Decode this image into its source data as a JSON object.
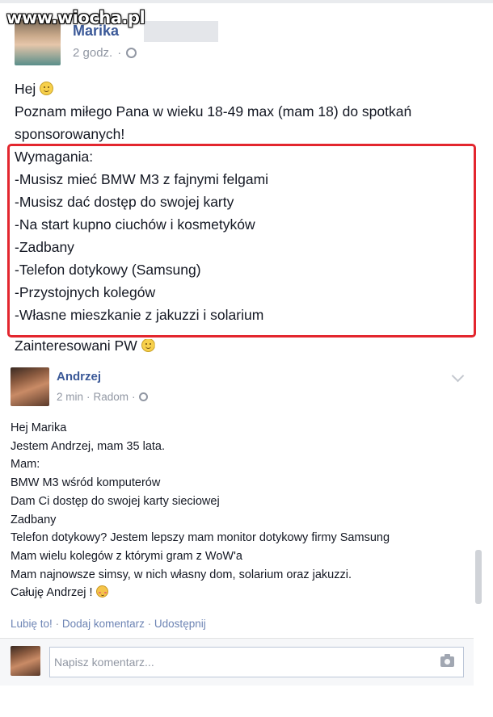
{
  "watermark": "www.wiocha.pl",
  "post": {
    "author": "Marika",
    "time": "2 godz.",
    "privacy_icon": "globe-icon",
    "greeting": "Hej",
    "line1": "Poznam miłego Pana w wieku 18-49 max (mam 18) do spotkań",
    "line2": "sponsorowanych!",
    "requirements": [
      "Wymagania:",
      "-Musisz mieć BMW M3 z fajnymi felgami",
      "-Musisz dać dostęp do swojej karty",
      "-Na start kupno ciuchów i kosmetyków",
      "-Zadbany",
      "-Telefon dotykowy (Samsung)",
      "-Przystojnych kolegów",
      "-Własne mieszkanie z jakuzzi i solarium"
    ],
    "closing": "Zainteresowani PW",
    "highlight_color": "#e3262e"
  },
  "comment": {
    "author": "Andrzej",
    "time": "2 min",
    "location": "Radom",
    "privacy_icon": "globe-icon",
    "lines": [
      "Hej Marika",
      "Jestem Andrzej, mam 35 lata.",
      "Mam:",
      "BMW M3 wśród komputerów",
      "Dam Ci dostęp do swojej karty sieciowej",
      "Zadbany",
      "Telefon dotykowy? Jestem lepszy mam monitor dotykowy firmy Samsung",
      "Mam wielu kolegów z którymi gram z WoW'a",
      "Mam najnowsze simsy, w nich własny dom, solarium oraz jakuzzi.",
      "Całuję Andrzej !"
    ]
  },
  "actions": {
    "like": "Lubię to!",
    "comment": "Dodaj komentarz",
    "share": "Udostępnij",
    "separator": "·"
  },
  "reply": {
    "placeholder": "Napisz komentarz..."
  },
  "colors": {
    "link": "#3b5998",
    "meta": "#9197a3",
    "text": "#141823"
  }
}
